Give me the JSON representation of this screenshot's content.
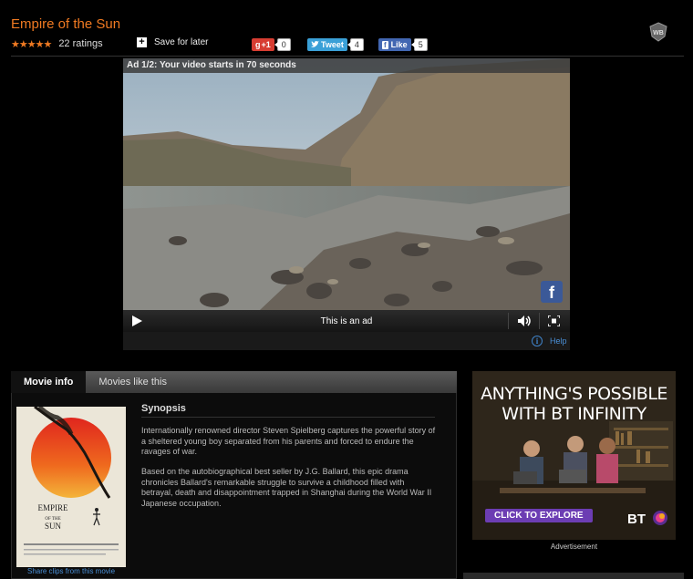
{
  "movie": {
    "title": "Empire of the Sun",
    "stars": "★★★★★",
    "ratings": "22 ratings",
    "save_label": "Save for later"
  },
  "social": {
    "gplus_label": "+1",
    "gplus_count": "0",
    "tweet_label": "Tweet",
    "tweet_count": "4",
    "like_label": "Like",
    "like_count": "5"
  },
  "player": {
    "ad_banner": "Ad 1/2: Your video starts in 70 seconds",
    "controls_text": "This is an ad",
    "help_label": "Help"
  },
  "tabs": [
    {
      "label": "Movie info",
      "active": true
    },
    {
      "label": "Movies like this",
      "active": false
    }
  ],
  "movie_info": {
    "synopsis_heading": "Synopsis",
    "paragraph1": "Internationally renowned director Steven Spielberg captures the powerful story of a sheltered young boy separated from his parents and forced to endure the ravages of war.",
    "paragraph2": "Based on the autobiographical best seller by J.G. Ballard, this epic drama chronicles Ballard's remarkable struggle to survive a childhood filled with betrayal, death and disappointment trapped in Shanghai during the World War II Japanese occupation.",
    "share_clips": "Share clips from this movie"
  },
  "advert": {
    "headline_line1": "ANYTHING'S POSSIBLE",
    "headline_line2": "WITH BT INFINITY",
    "cta": "CLICK TO EXPLORE",
    "brand": "BT",
    "label": "Advertisement"
  },
  "colors": {
    "accent": "#f07a22",
    "link": "#4a8fd6"
  }
}
